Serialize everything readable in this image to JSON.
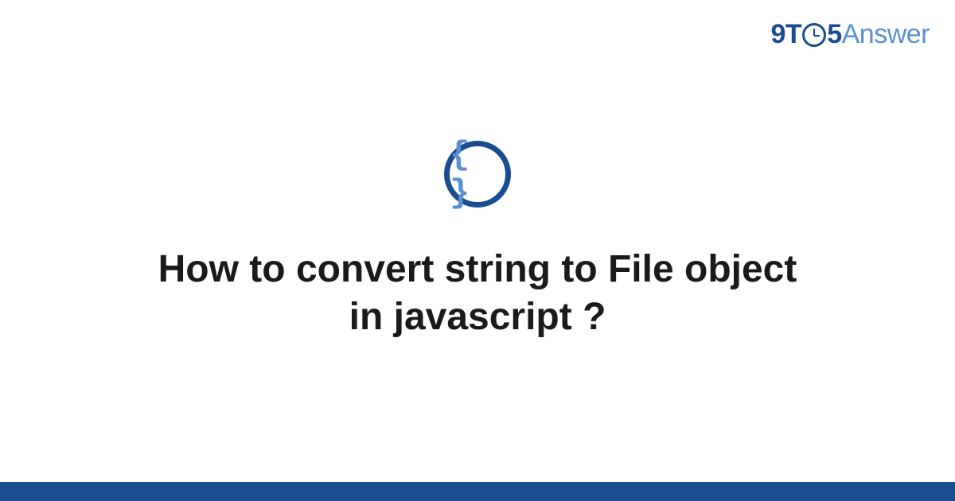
{
  "logo": {
    "prefix": "9T",
    "middle": "5",
    "suffix": "Answer"
  },
  "icon": {
    "braces": "{ }"
  },
  "title": "How to convert string to File object in javascript ?"
}
